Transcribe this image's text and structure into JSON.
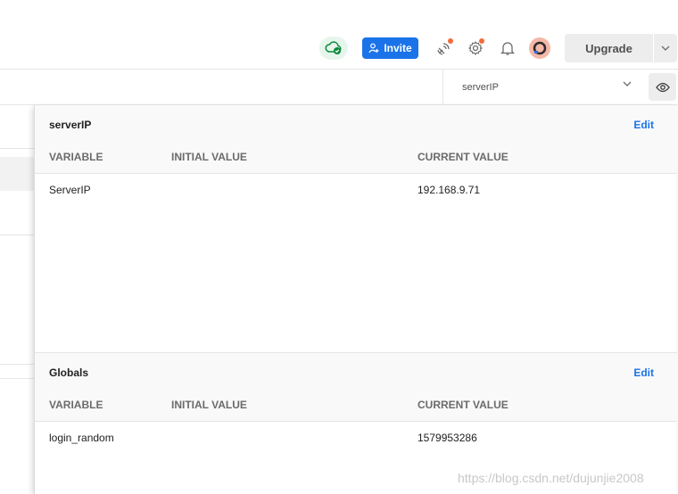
{
  "header": {
    "invite_label": "Invite",
    "upgrade_label": "Upgrade",
    "icons": [
      "cloud-sync-icon",
      "user-plus-icon",
      "satellite-icon",
      "settings-icon",
      "bell-icon",
      "avatar",
      "chevron-down-icon"
    ],
    "colors": {
      "accent": "#1a73e8",
      "notification": "#f26b3a",
      "sync_ok": "#0a8a3a"
    }
  },
  "environment": {
    "selected": "serverIP",
    "eye_icon": "eye-icon"
  },
  "panel": {
    "env_section": {
      "title": "serverIP",
      "edit_label": "Edit",
      "columns": [
        "VARIABLE",
        "INITIAL VALUE",
        "CURRENT VALUE"
      ],
      "rows": [
        {
          "variable": "ServerIP",
          "initial": "",
          "current": "192.168.9.71"
        }
      ]
    },
    "globals_section": {
      "title": "Globals",
      "edit_label": "Edit",
      "columns": [
        "VARIABLE",
        "INITIAL VALUE",
        "CURRENT VALUE"
      ],
      "rows": [
        {
          "variable": "login_random",
          "initial": "",
          "current": "1579953286"
        }
      ]
    }
  },
  "watermark": "https://blog.csdn.net/dujunjie2008"
}
